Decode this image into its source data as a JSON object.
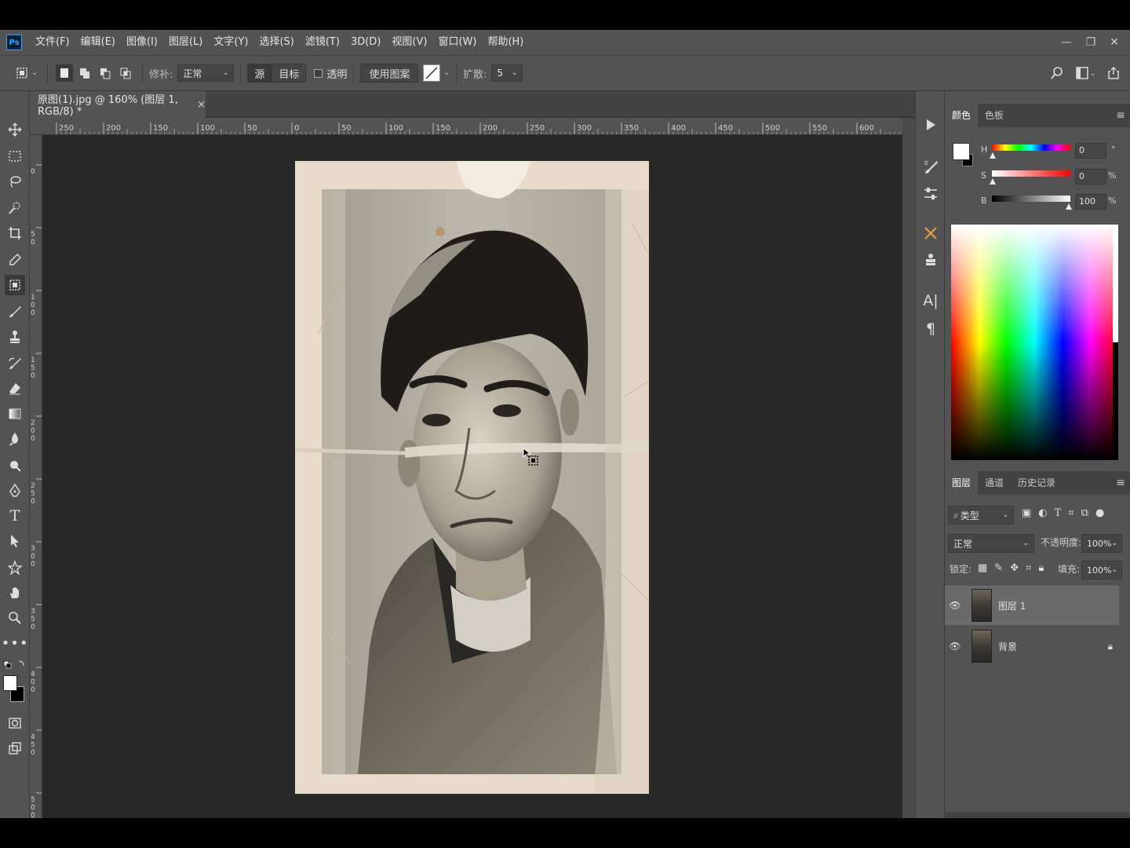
{
  "app": {
    "logo": "Ps"
  },
  "menubar": {
    "items": [
      "文件(F)",
      "编辑(E)",
      "图像(I)",
      "图层(L)",
      "文字(Y)",
      "选择(S)",
      "滤镜(T)",
      "3D(D)",
      "视图(V)",
      "窗口(W)",
      "帮助(H)"
    ],
    "minimize": "—",
    "restore": "❐",
    "close": "✕"
  },
  "options": {
    "patch_label": "修补:",
    "patch_mode": "正常",
    "source": "源",
    "target": "目标",
    "transparent": "透明",
    "use_pattern": "使用图案",
    "diffusion_label": "扩散:",
    "diffusion_value": "5"
  },
  "document": {
    "tab_title": "原图(1).jpg @ 160% (图层 1, RGB/8) *",
    "close": "×"
  },
  "hruler": [
    "250",
    "200",
    "150",
    "100",
    "50",
    "0",
    "50",
    "100",
    "150",
    "200",
    "250",
    "300",
    "350",
    "400",
    "450",
    "500",
    "550",
    "600"
  ],
  "vruler": [
    "0",
    "5 0",
    "1 0 0",
    "1 5 0",
    "2 0 0",
    "2 5 0",
    "3 0 0",
    "3 5 0",
    "4 0 0",
    "4 5 0",
    "5 0 0"
  ],
  "color_panel": {
    "tabs": [
      "颜色",
      "色板"
    ],
    "h_label": "H",
    "h_value": "0",
    "h_unit": "°",
    "s_label": "S",
    "s_value": "0",
    "s_unit": "%",
    "b_label": "B",
    "b_value": "100",
    "b_unit": "%",
    "foreground": "#ffffff",
    "background": "#000000"
  },
  "layers_panel": {
    "tabs": [
      "图层",
      "通道",
      "历史记录"
    ],
    "filter_kind": "类型",
    "blend_mode": "正常",
    "opacity_label": "不透明度:",
    "opacity_value": "100%",
    "lock_label": "锁定:",
    "fill_label": "填充:",
    "fill_value": "100%",
    "layers": [
      {
        "name": "图层 1",
        "selected": true
      },
      {
        "name": "背景",
        "locked": true
      }
    ]
  },
  "colors": {
    "accent": "#31a8ff",
    "panel": "#535353",
    "canvas": "#282828"
  }
}
